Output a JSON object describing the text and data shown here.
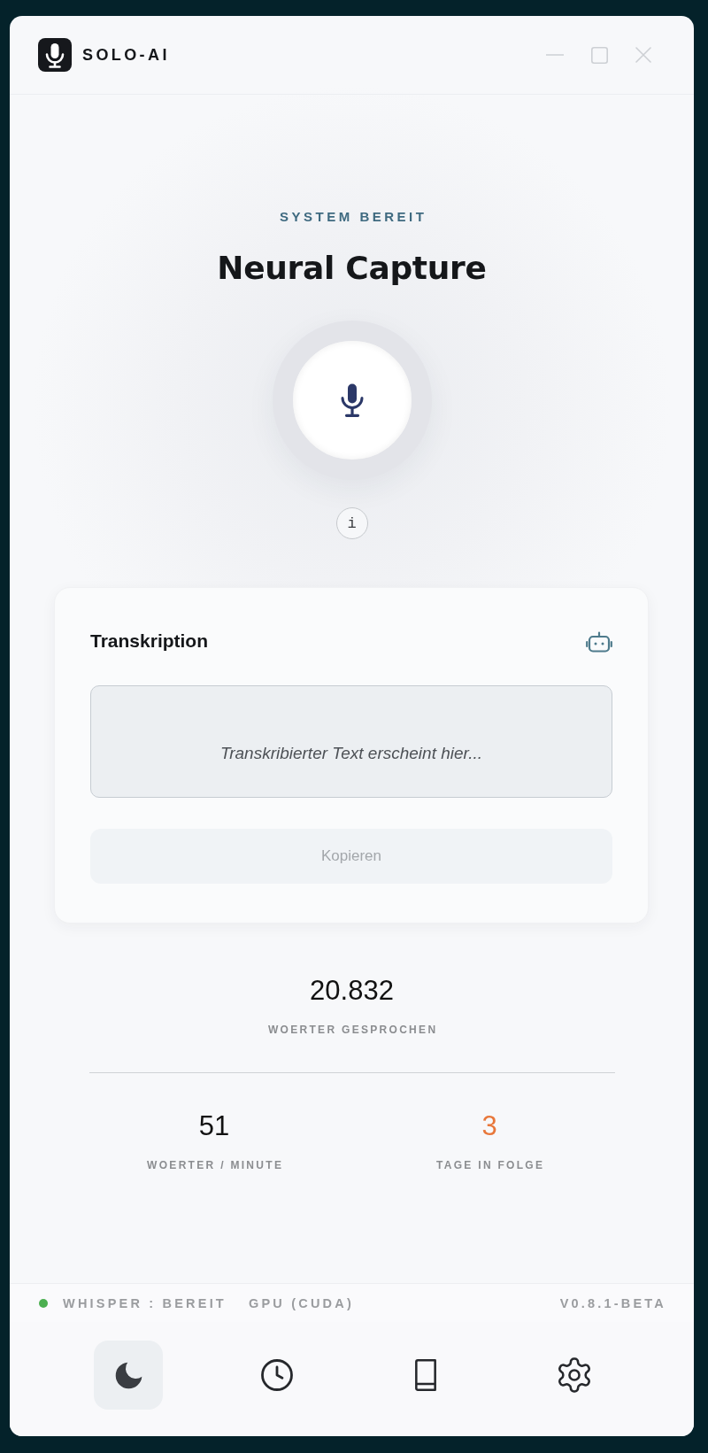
{
  "window": {
    "app_name": "SOLO-AI"
  },
  "hero": {
    "status": "SYSTEM BEREIT",
    "title": "Neural Capture",
    "info_button": "i"
  },
  "transcription": {
    "title": "Transkription",
    "placeholder": "Transkribierter Text erscheint hier...",
    "copy_button": {
      "label": "Kopieren",
      "disabled": true
    }
  },
  "stats": {
    "primary": {
      "value": "20.832",
      "label": "WOERTER GESPROCHEN"
    },
    "secondary": [
      {
        "value": "51",
        "label": "WOERTER / MINUTE",
        "color": "#111111"
      },
      {
        "value": "3",
        "label": "TAGE IN FOLGE",
        "color": "#e8773a"
      }
    ]
  },
  "status_bar": {
    "items": [
      {
        "text": "WHISPER : BEREIT",
        "color": "#4caf50"
      },
      {
        "text": "GPU (CUDA)"
      }
    ],
    "version": "V0.8.1-BETA"
  },
  "nav": [
    {
      "kind": "moon",
      "selected": true
    },
    {
      "kind": "clock",
      "selected": false
    },
    {
      "kind": "book",
      "selected": false
    },
    {
      "kind": "settings",
      "selected": false
    }
  ]
}
